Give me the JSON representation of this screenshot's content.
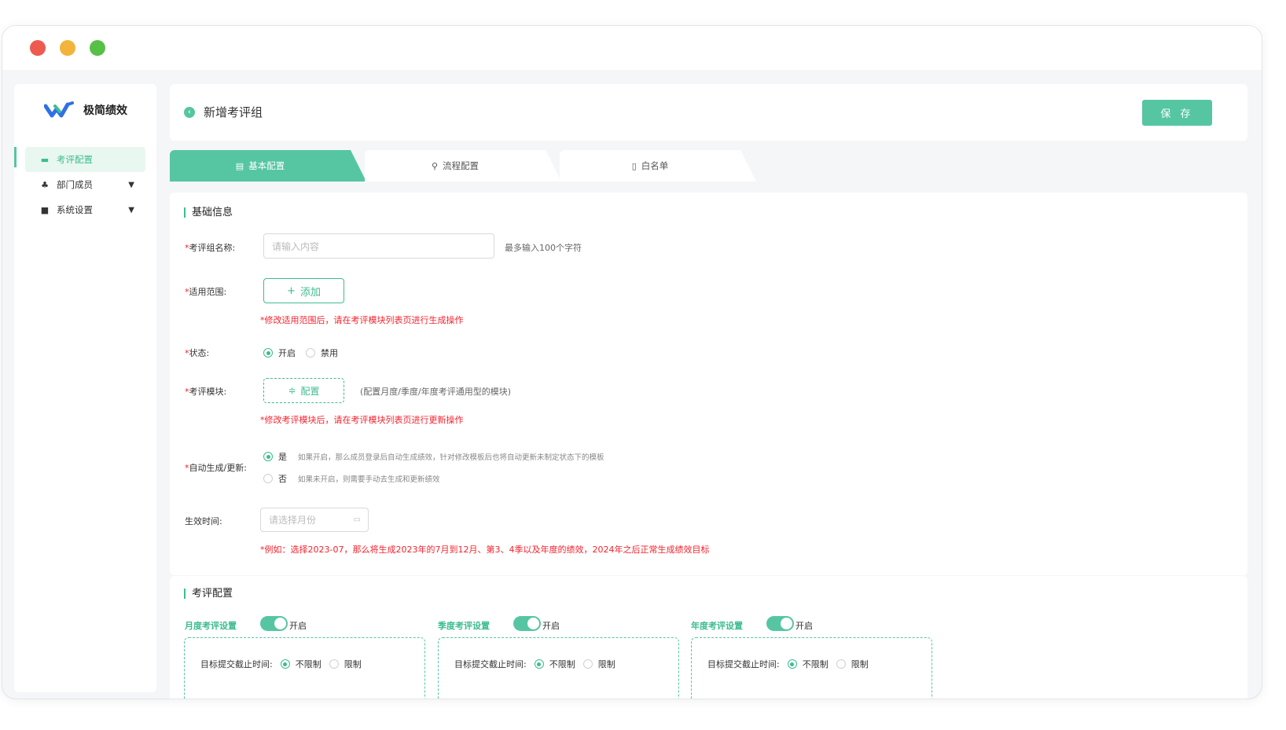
{
  "app": {
    "name": "极简绩效"
  },
  "sidebar": {
    "items": [
      {
        "label": "考评配置",
        "icon": "folder-icon",
        "active": true
      },
      {
        "label": "部门成员",
        "icon": "people-icon",
        "expandable": true
      },
      {
        "label": "系统设置",
        "icon": "settings-icon",
        "expandable": true
      }
    ]
  },
  "header": {
    "title": "新增考评组",
    "save_label": "保 存"
  },
  "tabs": [
    {
      "label": "基本配置",
      "active": true
    },
    {
      "label": "流程配置"
    },
    {
      "label": "白名单"
    }
  ],
  "basic": {
    "section_title": "基础信息",
    "name": {
      "label": "考评组名称:",
      "placeholder": "请输入内容",
      "hint": "最多输入100个字符"
    },
    "scope": {
      "label": "适用范围:",
      "add_label": "添加",
      "warning": "*修改适用范围后，请在考评模块列表页进行生成操作"
    },
    "status": {
      "label": "状态:",
      "options": [
        "开启",
        "禁用"
      ],
      "selected": "开启"
    },
    "module": {
      "label": "考评模块:",
      "config_label": "配置",
      "hint": "(配置月度/季度/年度考评通用型的模块)",
      "warning": "*修改考评模块后，请在考评模块列表页进行更新操作"
    },
    "auto": {
      "label": "自动生成/更新:",
      "options": [
        {
          "value": "是",
          "desc": "如果开启，那么成员登录后自动生成绩效，针对修改模板后也将自动更新未制定状态下的模板",
          "selected": true
        },
        {
          "value": "否",
          "desc": "如果未开启，则需要手动去生成和更新绩效",
          "selected": false
        }
      ]
    },
    "effective": {
      "label": "生效时间:",
      "placeholder": "请选择月份",
      "warning": "*例如：选择2023-07，那么将生成2023年的7月到12月、第3、4季以及年度的绩效，2024年之后正常生成绩效目标"
    }
  },
  "review": {
    "section_title": "考评配置",
    "groups": [
      {
        "label": "月度考评设置",
        "switch_text": "开启",
        "row_label": "目标提交截止时间:",
        "options": [
          "不限制",
          "限制"
        ],
        "selected": "不限制"
      },
      {
        "label": "季度考评设置",
        "switch_text": "开启",
        "row_label": "目标提交截止时间:",
        "options": [
          "不限制",
          "限制"
        ],
        "selected": "不限制"
      },
      {
        "label": "年度考评设置",
        "switch_text": "开启",
        "row_label": "目标提交截止时间:",
        "options": [
          "不限制",
          "限制"
        ],
        "selected": "不限制"
      }
    ]
  },
  "colors": {
    "accent": "#55c6a1",
    "danger": "#f5222d"
  }
}
